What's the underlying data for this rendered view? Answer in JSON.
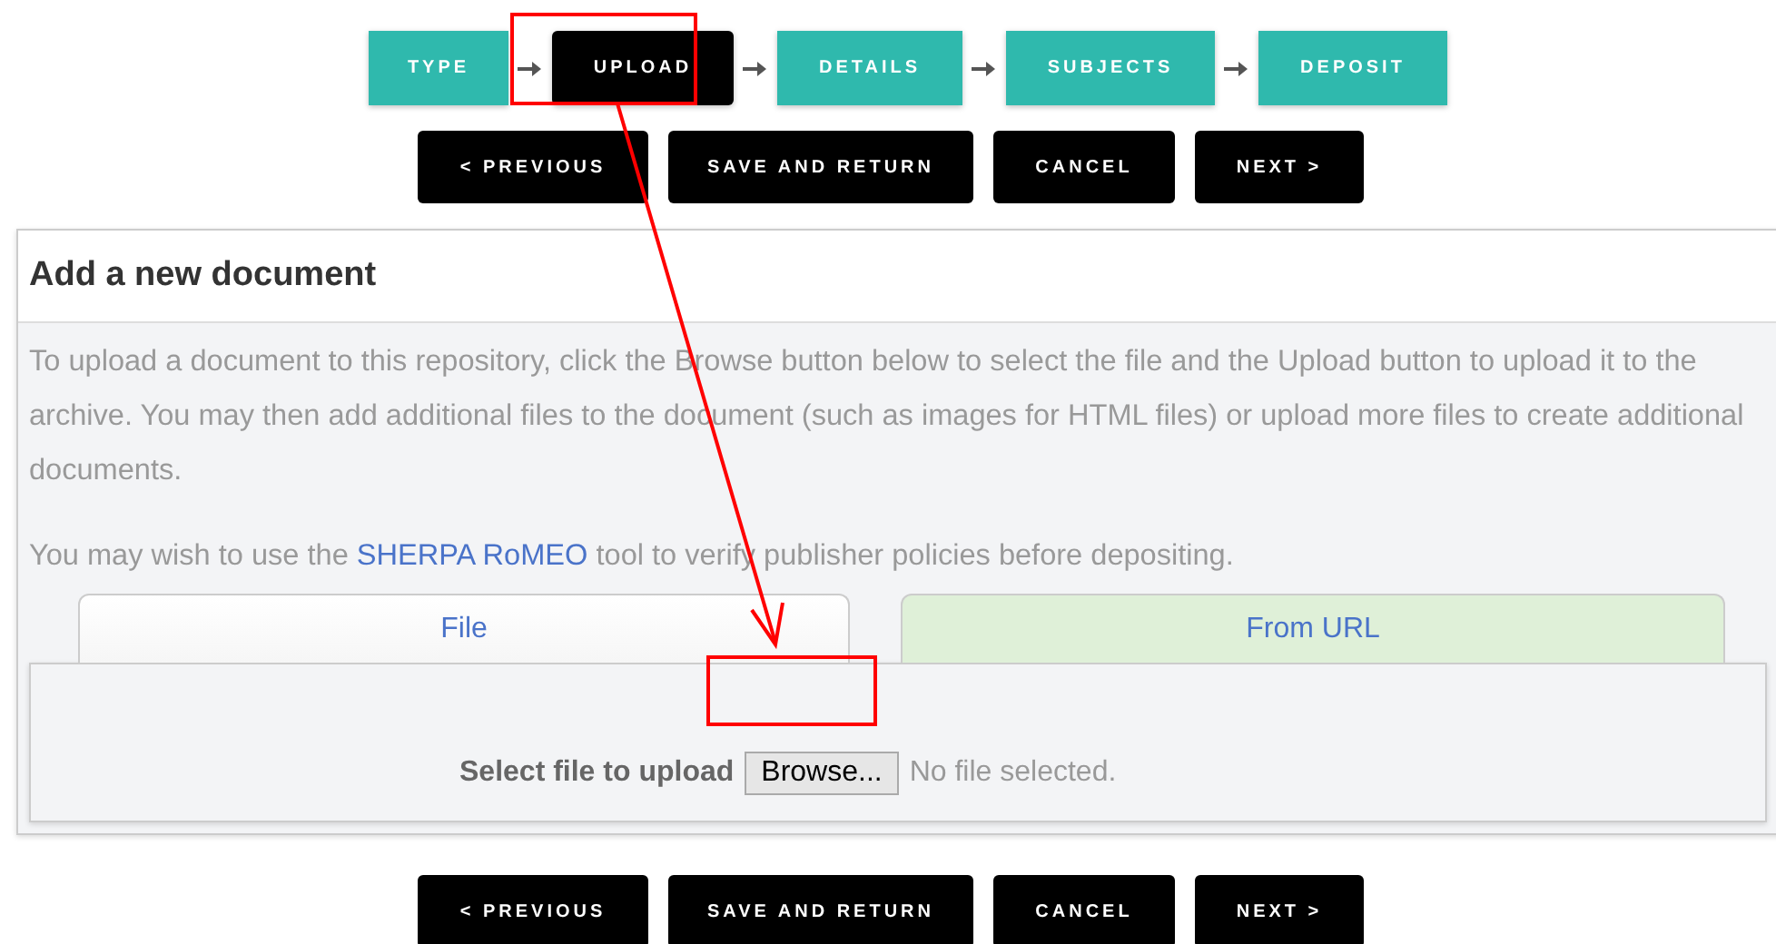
{
  "steps": [
    {
      "label": "TYPE",
      "selected": false
    },
    {
      "label": "UPLOAD",
      "selected": true
    },
    {
      "label": "DETAILS",
      "selected": false
    },
    {
      "label": "SUBJECTS",
      "selected": false
    },
    {
      "label": "DEPOSIT",
      "selected": false
    }
  ],
  "buttons_top": [
    "< PREVIOUS",
    "SAVE AND RETURN",
    "CANCEL",
    "NEXT >"
  ],
  "panel": {
    "title": "Add a new document",
    "intro": "To upload a document to this repository, click the Browse button below to select the file and the Upload button to upload it to the archive. You may then add additional files to the document (such as images for HTML files) or upload more files to create additional documents.",
    "note_before": "You may wish to use the",
    "note_link": "SHERPA RoMEO",
    "note_after": "tool to verify publisher policies before depositing.",
    "tabs": [
      {
        "label": "File",
        "selected": true
      },
      {
        "label": "From URL",
        "selected": false
      }
    ],
    "upload": {
      "label": "Select file to upload",
      "button": "Browse...",
      "status": "No file selected."
    }
  },
  "buttons_bottom": [
    "< PREVIOUS",
    "SAVE AND RETURN",
    "CANCEL",
    "NEXT >"
  ]
}
